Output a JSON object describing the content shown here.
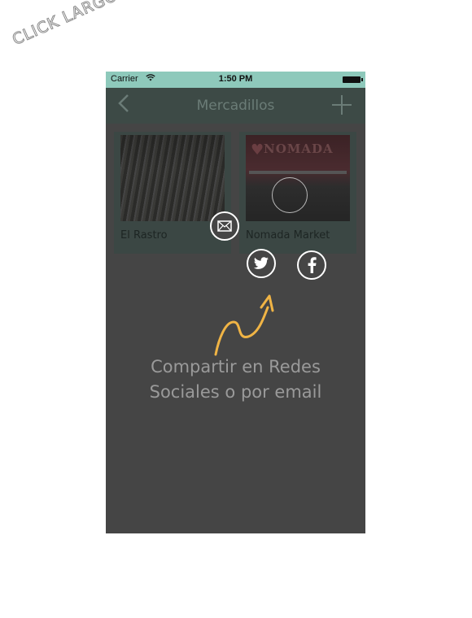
{
  "corner_label": "CLICK LARGO",
  "status": {
    "carrier": "Carrier",
    "time": "1:50 PM"
  },
  "nav": {
    "title": "Mercadillos",
    "back_icon": "chevron-left-icon",
    "add_icon": "plus-icon"
  },
  "markets": [
    {
      "label": "El Rastro"
    },
    {
      "label": "Nomada Market",
      "sign": "NOMADA"
    }
  ],
  "share": {
    "icons": [
      "mail-icon",
      "twitter-icon",
      "facebook-icon"
    ]
  },
  "caption": {
    "line1": "Compartir en Redes",
    "line2": "Sociales o por email"
  },
  "colors": {
    "status_bar": "#8ec9bb",
    "nav_bar": "#3d4a46",
    "background": "#454545",
    "arrow": "#f0b445",
    "caption": "#9a9a9a"
  }
}
